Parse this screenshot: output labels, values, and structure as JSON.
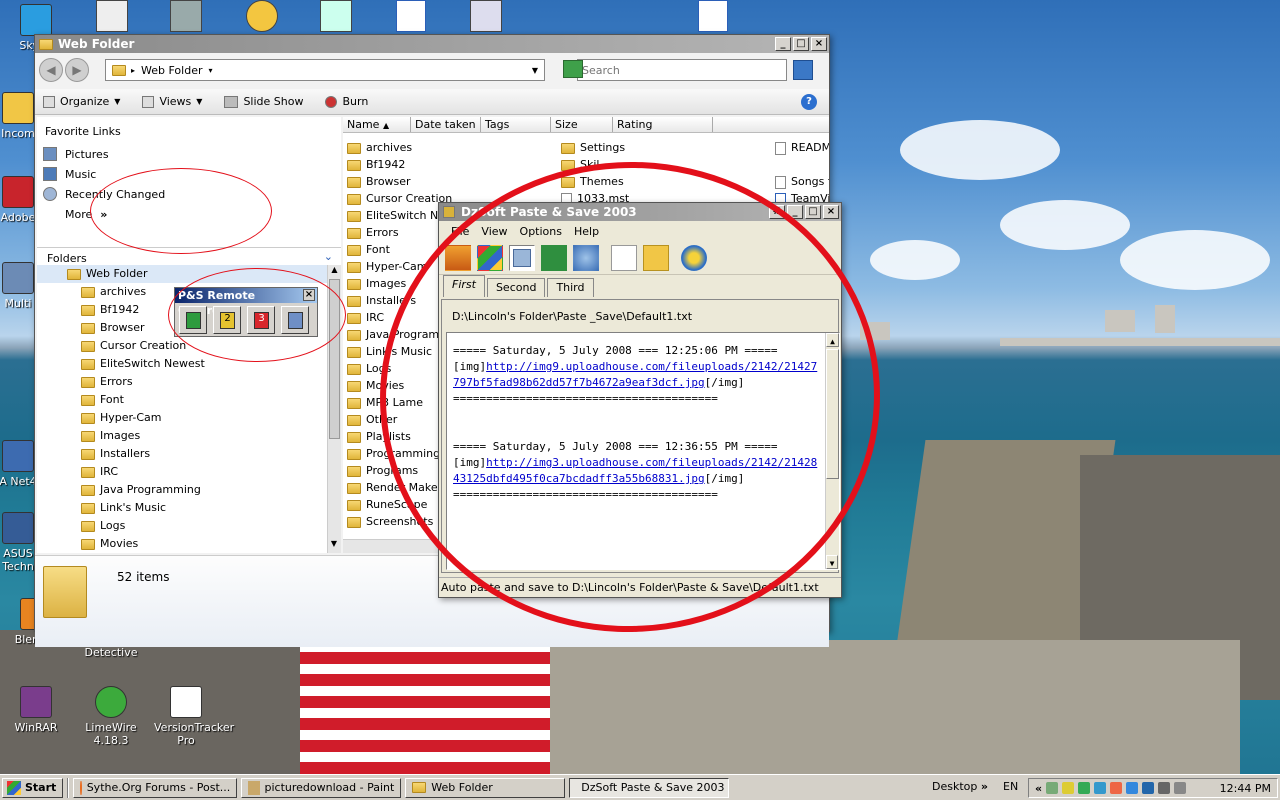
{
  "desktop": {
    "icons": [
      {
        "label": "Skype",
        "color": "#2a9de0"
      },
      {
        "label": "Incom",
        "color": "#f1c645"
      },
      {
        "label": "Adobe",
        "color": "#c8242c"
      },
      {
        "label": "Multi",
        "color": "#6c8bb5"
      },
      {
        "label": "A Net4",
        "color": "#3d6bb0"
      },
      {
        "label": "ASUS Techn",
        "color": "#355c96"
      },
      {
        "label": "Blender",
        "color": "#e88420"
      },
      {
        "label": "Driver Detective",
        "color": "#555555"
      },
      {
        "label": "WinRAR",
        "color": "#7a3d8c"
      },
      {
        "label": "LimeWire 4.18.3",
        "color": "#3caa3c"
      },
      {
        "label": "VersionTracker Pro",
        "color": "#ffffff"
      }
    ]
  },
  "explorer": {
    "title": "Web Folder",
    "address": "Web Folder",
    "search_placeholder": "Search",
    "toolbar": {
      "organize": "Organize",
      "views": "Views",
      "slideshow": "Slide Show",
      "burn": "Burn"
    },
    "favorites_title": "Favorite Links",
    "favorites": [
      "Pictures",
      "Music",
      "Recently Changed",
      "More"
    ],
    "more_chevron": "»",
    "folders_title": "Folders",
    "tree_root": "Web Folder",
    "tree": [
      "archives",
      "Bf1942",
      "Browser",
      "Cursor Creation",
      "EliteSwitch Newest",
      "Errors",
      "Font",
      "Hyper-Cam",
      "Images",
      "Installers",
      "IRC",
      "Java Programming",
      "Link's Music",
      "Logs",
      "Movies"
    ],
    "columns": [
      "Name",
      "Date taken",
      "Tags",
      "Size",
      "Rating"
    ],
    "files_col1": [
      "archives",
      "Bf1942",
      "Browser",
      "Cursor Creation",
      "EliteSwitch Newest",
      "Errors",
      "Font",
      "Hyper-Cam",
      "Images",
      "Installers",
      "IRC",
      "Java Programming",
      "Link's Music",
      "Logs",
      "Movies",
      "MP3 Lame",
      "Other",
      "Playlists",
      "Programming H",
      "Programs",
      "Render Maker",
      "RuneScape",
      "Screenshots"
    ],
    "files_col2": [
      "Settings",
      "Skil",
      "Themes",
      "1033.mst"
    ],
    "files_col3": [
      "READM",
      "",
      "Songs f",
      "TeamVi"
    ],
    "status": "52 items"
  },
  "remote": {
    "title": "P&S Remote Control",
    "close": "×",
    "button_colors": [
      "#2e9b3e",
      "#e5c22f",
      "#d8262c",
      "#6f8fc6"
    ],
    "button_labels": [
      "",
      "2",
      "3",
      ""
    ]
  },
  "dzsoft": {
    "title": "DzSoft Paste & Save 2003",
    "menu": [
      "File",
      "View",
      "Options",
      "Help"
    ],
    "tabs": [
      "First",
      "Second",
      "Third"
    ],
    "path": "D:\\Lincoln's Folder\\Paste _Save\\Default1.txt",
    "entries": [
      {
        "header": "===== Saturday, 5 July 2008 === 12:25:06 PM =====",
        "open_tag": "[img]",
        "url": "http://img9.uploadhouse.com/fileuploads/2142/21427797bf5fad98b62dd57f7b4672a9eaf3dcf.jpg",
        "close_tag": "[/img]",
        "footer": "========================================"
      },
      {
        "header": "===== Saturday, 5 July 2008 === 12:36:55 PM =====",
        "open_tag": "[img]",
        "url": "http://img3.uploadhouse.com/fileuploads/2142/2142843125dbfd495f0ca7bcdadff3a55b68831.jpg",
        "close_tag": "[/img]",
        "footer": "========================================"
      }
    ],
    "status": "Auto paste and save to D:\\Lincoln's Folder\\Paste & Save\\Default1.txt"
  },
  "taskbar": {
    "start": "Start",
    "tasks": [
      "Sythe.Org Forums - Post...",
      "picturedownload - Paint",
      "Web Folder",
      "DzSoft Paste & Save 2003"
    ],
    "desktop_label": "Desktop",
    "desktop_chevron": "»",
    "lang": "EN",
    "tray_chevron": "«",
    "clock": "12:44 PM"
  },
  "colors": {
    "annotation": "#e3101a",
    "link": "#0000cc"
  }
}
